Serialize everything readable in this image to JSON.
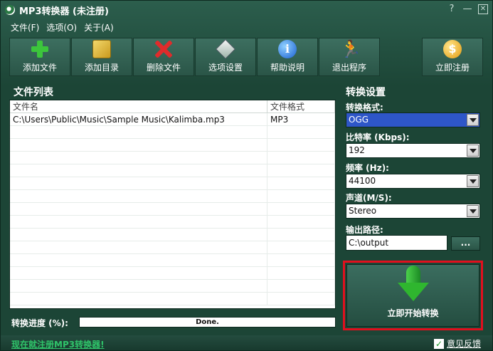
{
  "window": {
    "title": "MP3转换器 (未注册)",
    "help": "?",
    "minimize": "—",
    "close": "⊠"
  },
  "menu": [
    {
      "label": "文件(F)"
    },
    {
      "label": "选项(O)"
    },
    {
      "label": "关于(A)"
    }
  ],
  "toolbar": {
    "add_file": "添加文件",
    "add_dir": "添加目录",
    "delete_file": "删除文件",
    "options": "选项设置",
    "help": "帮助说明",
    "exit": "退出程序",
    "register": "立即注册"
  },
  "file_list": {
    "title": "文件列表",
    "columns": {
      "name": "文件名",
      "format": "文件格式"
    },
    "rows": [
      {
        "name": "C:\\Users\\Public\\Music\\Sample Music\\Kalimba.mp3",
        "format": "MP3"
      }
    ]
  },
  "settings": {
    "title": "转换设置",
    "format_label": "转换格式:",
    "format_value": "OGG",
    "bitrate_label": "比特率 (Kbps):",
    "bitrate_value": "192",
    "freq_label": "频率 (Hz):",
    "freq_value": "44100",
    "channel_label": "声道(M/S):",
    "channel_value": "Stereo",
    "output_label": "输出路径:",
    "output_value": "C:\\output",
    "browse": "...",
    "start": "立即开始转换"
  },
  "progress": {
    "label": "转换进度 (%):",
    "text": "Done.",
    "fraction": 1.0
  },
  "footer": {
    "register_link": "现在就注册MP3转换器!",
    "feedback": "意见反馈"
  }
}
